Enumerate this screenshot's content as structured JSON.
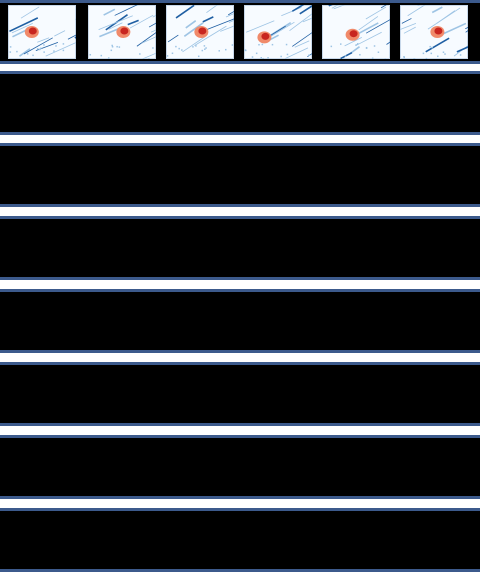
{
  "grid": {
    "rows": 8,
    "cols": 6,
    "colors": {
      "background": "#f7fbff",
      "structure": "#1f5fa3",
      "structure_light": "#9ec4e4",
      "object": "#c8251f",
      "object_light": "#f08a6a",
      "separator": "#3c5a8c"
    }
  }
}
